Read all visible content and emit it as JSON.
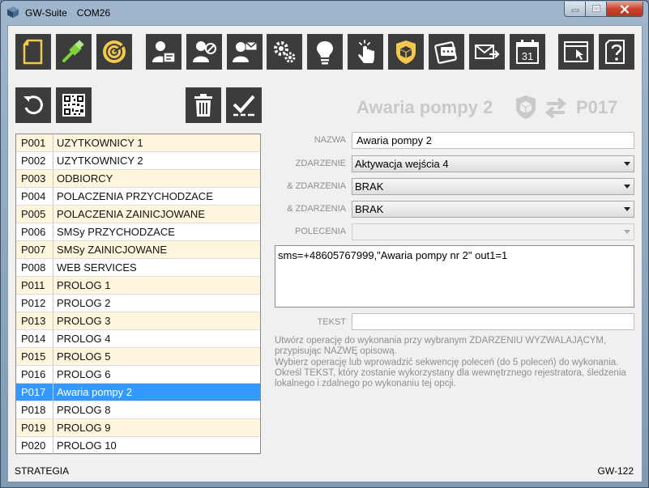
{
  "window": {
    "app_name": "GW-Suite",
    "port": "COM26"
  },
  "toolbar": {
    "icons": [
      "document-icon",
      "usb-icon",
      "radar-icon",
      "user-card-icon",
      "user-block-icon",
      "user-mail-icon",
      "gears-icon",
      "lightbulb-icon",
      "pointer-hand-icon",
      "shield-box-icon",
      "sms-icon",
      "send-mail-icon",
      "calendar-icon",
      "app-window-icon",
      "help-icon"
    ],
    "calendar_day": "31"
  },
  "operation_list": {
    "items": [
      {
        "code": "P001",
        "name": "UZYTKOWNICY 1"
      },
      {
        "code": "P002",
        "name": "UZYTKOWNICY 2"
      },
      {
        "code": "P003",
        "name": "ODBIORCY"
      },
      {
        "code": "P004",
        "name": "POLACZENIA PRZYCHODZACE"
      },
      {
        "code": "P005",
        "name": "POLACZENIA ZAINICJOWANE"
      },
      {
        "code": "P006",
        "name": "SMSy PRZYCHODZACE"
      },
      {
        "code": "P007",
        "name": "SMSy ZAINICJOWANE"
      },
      {
        "code": "P008",
        "name": "WEB SERVICES"
      },
      {
        "code": "P011",
        "name": "PROLOG 1"
      },
      {
        "code": "P012",
        "name": "PROLOG 2"
      },
      {
        "code": "P013",
        "name": "PROLOG 3"
      },
      {
        "code": "P014",
        "name": "PROLOG 4"
      },
      {
        "code": "P015",
        "name": "PROLOG 5"
      },
      {
        "code": "P016",
        "name": "PROLOG 6"
      },
      {
        "code": "P017",
        "name": "Awaria pompy 2"
      },
      {
        "code": "P018",
        "name": "PROLOG 8"
      },
      {
        "code": "P019",
        "name": "PROLOG 9"
      },
      {
        "code": "P020",
        "name": "PROLOG 10"
      }
    ],
    "selected_code": "P017"
  },
  "header": {
    "name": "Awaria pompy 2",
    "code": "P017"
  },
  "form": {
    "nazwa_label": "NAZWA",
    "nazwa_value": "Awaria pompy 2",
    "zdarzenie_label": "ZDARZENIE",
    "zdarzenie_value": "Aktywacja wejścia 4",
    "and_zdarzenia_label_1": "& ZDARZENIA",
    "and_zdarzenia_value_1": "BRAK",
    "and_zdarzenia_label_2": "& ZDARZENIA",
    "and_zdarzenia_value_2": "BRAK",
    "polecenia_label": "POLECENIA",
    "polecenia_value": "",
    "commands_text": "sms=+48605767999,\"Awaria pompy nr 2\" out1=1",
    "tekst_label": "TEKST",
    "tekst_value": ""
  },
  "info": {
    "line1": "Utwórz operację do wykonania przy wybranym ZDARZENIU WYZWALAJĄCYM, przypisując NAZWĘ opisową.",
    "line2": "Wybierz operację lub wprowadzić sekwencję poleceń (do 5 poleceń) do wykonania.",
    "line3": "Określ TEKST, który zostanie wykorzystany dla wewnętrznego rejestratora, śledzenia lokalnego i zdalnego po wykonaniu tej opcji."
  },
  "status": {
    "left": "STRATEGIA",
    "right": "GW-122"
  },
  "colors": {
    "toolbar_bg": "#3c3c3c",
    "icon_gold": "#f2c94c",
    "selection": "#3399ff",
    "row_alt": "#fdf6dc"
  }
}
